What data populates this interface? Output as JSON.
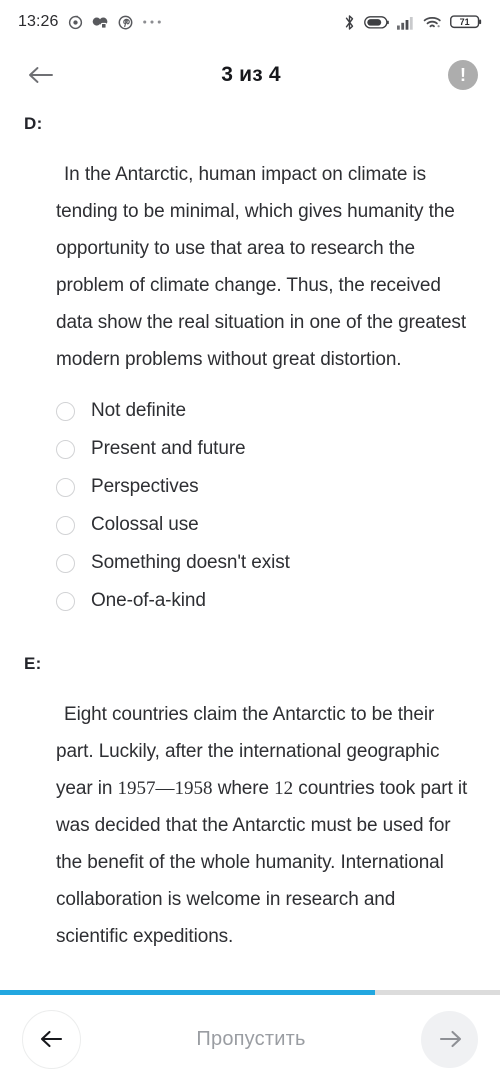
{
  "statusbar": {
    "time": "13:26",
    "icons_left": [
      "target-icon",
      "cards-icon",
      "pinterest-icon",
      "more-dots-icon"
    ],
    "icons_right": [
      "bluetooth-icon",
      "battery-case-icon",
      "signal-bars-icon",
      "wifi-icon",
      "battery-icon"
    ],
    "battery_level": "71"
  },
  "header": {
    "back_icon": "arrow-left-icon",
    "title": "3 из 4",
    "info_icon": "exclamation-icon",
    "info_glyph": "!"
  },
  "content": {
    "blocks": [
      {
        "label": "D:",
        "paragraph": "In the Antarctic, human impact on climate is tending to be minimal, which gives humanity the opportunity to use that area to research the problem of climate change. Thus, the received data show the real situation in one of the greatest modern problems without great distortion.",
        "options": [
          "Not definite",
          "Present and future",
          "Perspectives",
          "Colossal use",
          "Something doesn't exist",
          "One-of-a-kind"
        ]
      },
      {
        "label": "E:",
        "paragraph_part1": "Eight countries claim the Antarctic to be their part. Luckily, after the international geographic year in ",
        "paragraph_serif": "1957—1958",
        "paragraph_part2": " where ",
        "paragraph_serif2": "12",
        "paragraph_part3": " countries took part it was decided that the Antarctic must be used for the benefit of the whole humanity. International collaboration is welcome in research and scientific expeditions."
      }
    ]
  },
  "progress": {
    "percent": 75,
    "fill_color": "#22a7e0",
    "track_color": "#dcdcdc"
  },
  "bottombar": {
    "prev_icon": "arrow-left-icon",
    "skip_label": "Пропустить",
    "next_icon": "arrow-right-icon"
  }
}
